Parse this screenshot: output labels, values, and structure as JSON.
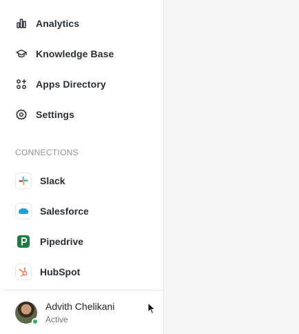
{
  "nav": {
    "items": [
      {
        "label": "Analytics",
        "icon": "bar-chart-icon"
      },
      {
        "label": "Knowledge Base",
        "icon": "graduation-cap-icon"
      },
      {
        "label": "Apps Directory",
        "icon": "apps-plus-icon"
      },
      {
        "label": "Settings",
        "icon": "gear-icon"
      }
    ]
  },
  "connections": {
    "section_label": "CONNECTIONS",
    "items": [
      {
        "label": "Slack",
        "icon": "slack-logo-icon"
      },
      {
        "label": "Salesforce",
        "icon": "salesforce-logo-icon"
      },
      {
        "label": "Pipedrive",
        "icon": "pipedrive-logo-icon"
      },
      {
        "label": "HubSpot",
        "icon": "hubspot-logo-icon"
      }
    ]
  },
  "user": {
    "name": "Advith Chelikani",
    "status": "Active",
    "status_color": "#2fb171"
  },
  "colors": {
    "text": "#2a2f36",
    "muted": "#8c9097",
    "pipedrive": "#1b7d3e",
    "salesforce": "#1ea1db",
    "hubspot": "#ff7a59"
  }
}
